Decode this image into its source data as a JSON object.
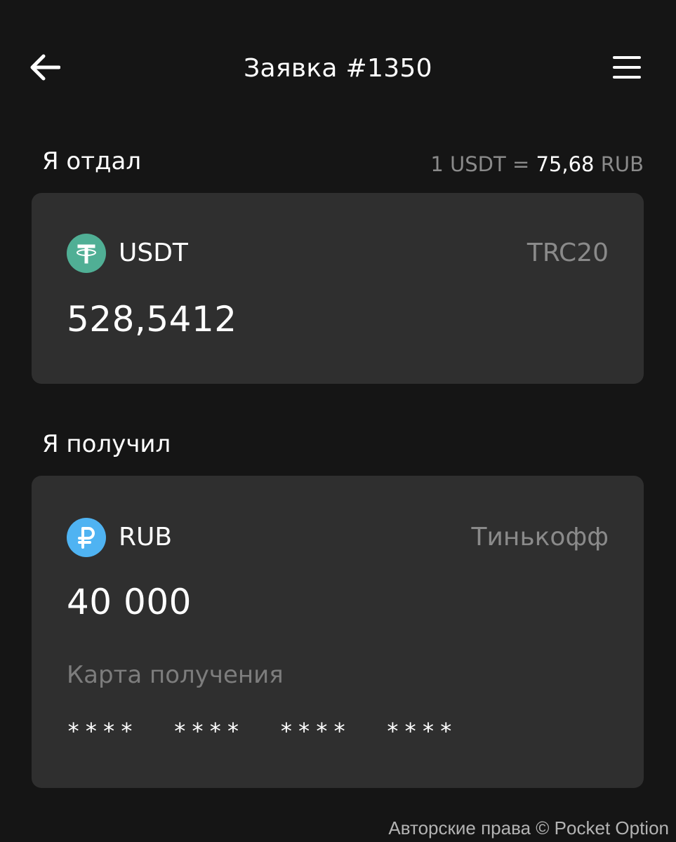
{
  "header": {
    "title": "Заявка #1350",
    "back_icon": "arrow-left-icon",
    "menu_icon": "hamburger-menu-icon"
  },
  "given": {
    "section_title": "Я отдал",
    "rate": {
      "prefix": "1 USDT =",
      "value": "75,68",
      "currency": "RUB"
    },
    "coin": {
      "name": "USDT",
      "icon": "tether-icon",
      "color": "#50AF95",
      "network": "TRC20"
    },
    "amount": "528,5412"
  },
  "received": {
    "section_title": "Я получил",
    "coin": {
      "name": "RUB",
      "icon": "ruble-icon",
      "color": "#4FB3F2",
      "bank": "Тинькофф"
    },
    "amount": "40 000",
    "card_label": "Карта получения",
    "card_number": "****  ****  ****  ****"
  },
  "footer": {
    "copyright": "Авторские права © Pocket Option"
  },
  "colors": {
    "background": "#151515",
    "card": "#2f2f2f",
    "muted_text": "#8a8a8a"
  }
}
